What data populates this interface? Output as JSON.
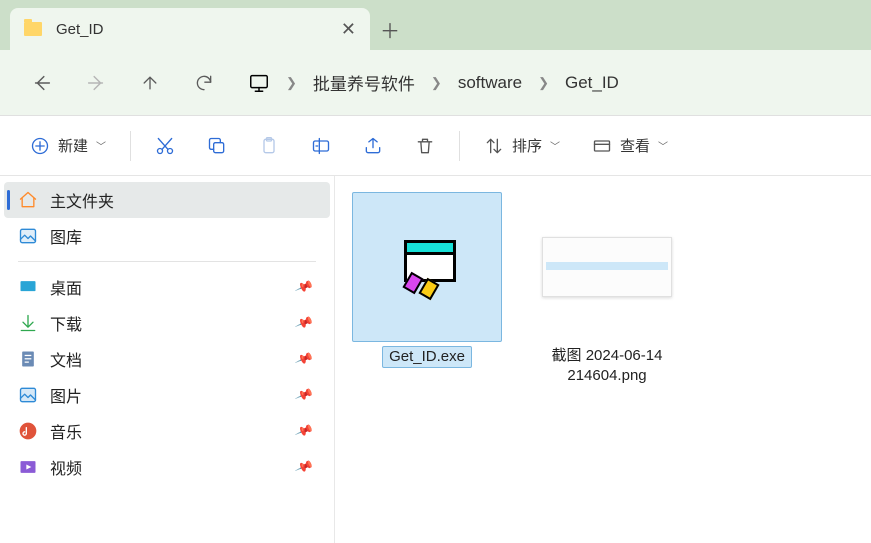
{
  "tab": {
    "title": "Get_ID"
  },
  "breadcrumb": {
    "items": [
      "批量养号软件",
      "software",
      "Get_ID"
    ]
  },
  "toolbar": {
    "new_label": "新建",
    "sort_label": "排序",
    "view_label": "查看"
  },
  "sidebar": {
    "home": "主文件夹",
    "gallery": "图库",
    "quick": [
      {
        "label": "桌面",
        "icon": "desktop"
      },
      {
        "label": "下载",
        "icon": "download"
      },
      {
        "label": "文档",
        "icon": "document"
      },
      {
        "label": "图片",
        "icon": "pictures"
      },
      {
        "label": "音乐",
        "icon": "music"
      },
      {
        "label": "视频",
        "icon": "video"
      }
    ]
  },
  "files": [
    {
      "name": "Get_ID.exe",
      "type": "exe",
      "selected": true
    },
    {
      "name": "截图 2024-06-14 214604.png",
      "type": "png",
      "selected": false
    }
  ],
  "colors": {
    "accent": "#2e6cd6",
    "selection": "#cde7f8",
    "tabbar": "#ccdfc9",
    "chrome": "#eff6ee"
  }
}
